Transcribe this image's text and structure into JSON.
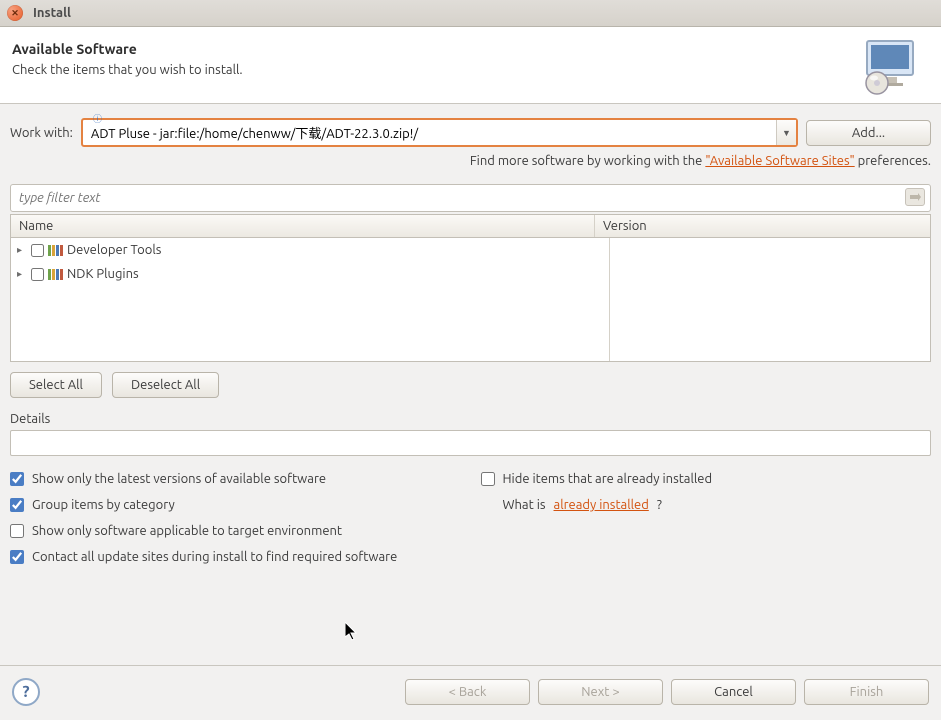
{
  "window": {
    "title": "Install"
  },
  "header": {
    "title": "Available Software",
    "subtitle": "Check the items that you wish to install."
  },
  "workwith": {
    "label": "Work with:",
    "value": "ADT Pluse - jar:file:/home/chenww/下载/ADT-22.3.0.zip!/",
    "add_label": "Add..."
  },
  "linkrow": {
    "prefix": "Find more software by working with the ",
    "link": "\"Available Software Sites\"",
    "suffix": " preferences."
  },
  "filter": {
    "placeholder": "type filter text"
  },
  "columns": {
    "name": "Name",
    "version": "Version"
  },
  "tree": [
    {
      "label": "Developer Tools",
      "checked": false
    },
    {
      "label": "NDK Plugins",
      "checked": false
    }
  ],
  "selectbar": {
    "select_all": "Select All",
    "deselect_all": "Deselect All"
  },
  "details": {
    "label": "Details"
  },
  "options": {
    "latest": {
      "label": "Show only the latest versions of available software",
      "checked": true
    },
    "hide": {
      "label": "Hide items that are already installed",
      "checked": false
    },
    "group": {
      "label": "Group items by category",
      "checked": true
    },
    "whatis_prefix": "What is ",
    "whatis_link": "already installed",
    "whatis_suffix": "?",
    "target": {
      "label": "Show only software applicable to target environment",
      "checked": false
    },
    "contact": {
      "label": "Contact all update sites during install to find required software",
      "checked": true
    }
  },
  "footer": {
    "back": "< Back",
    "next": "Next >",
    "cancel": "Cancel",
    "finish": "Finish"
  }
}
